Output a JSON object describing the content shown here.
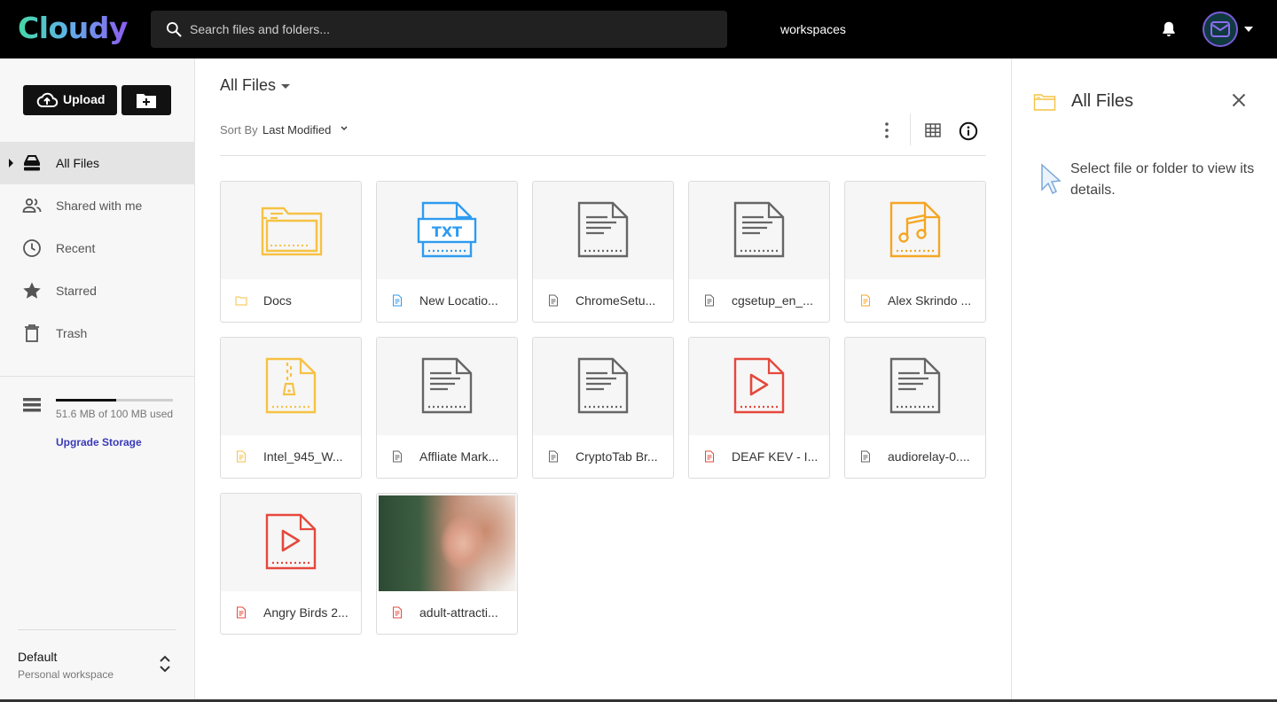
{
  "header": {
    "logo": "Cloudy",
    "search_placeholder": "Search files and folders...",
    "workspaces_label": "workspaces"
  },
  "sidebar": {
    "upload_label": "Upload",
    "nav": [
      {
        "label": "All Files",
        "icon": "hard-drive-icon",
        "active": true
      },
      {
        "label": "Shared with me",
        "icon": "people-icon"
      },
      {
        "label": "Recent",
        "icon": "clock-icon"
      },
      {
        "label": "Starred",
        "icon": "star-icon"
      },
      {
        "label": "Trash",
        "icon": "trash-icon"
      }
    ],
    "storage": {
      "used_text": "51.6 MB of 100 MB used",
      "used_fraction": 0.516,
      "upgrade_label": "Upgrade Storage"
    },
    "workspace": {
      "name": "Default",
      "subtitle": "Personal workspace"
    }
  },
  "main": {
    "title": "All Files",
    "sort_by_label": "Sort By",
    "sort_value": "Last Modified",
    "files": [
      {
        "name": "Docs",
        "type": "folder",
        "color": "#f6c244"
      },
      {
        "name": "New Locatio...",
        "type": "txt",
        "color": "#2e9bf0"
      },
      {
        "name": "ChromeSetu...",
        "type": "document",
        "color": "#666666"
      },
      {
        "name": "cgsetup_en_...",
        "type": "document",
        "color": "#666666"
      },
      {
        "name": "Alex Skrindo ...",
        "type": "audio",
        "color": "#f5a623"
      },
      {
        "name": "Intel_945_W...",
        "type": "archive",
        "color": "#f6c244"
      },
      {
        "name": "Affliate Mark...",
        "type": "document",
        "color": "#666666"
      },
      {
        "name": "CryptoTab Br...",
        "type": "document",
        "color": "#666666"
      },
      {
        "name": "DEAF KEV - I...",
        "type": "video",
        "color": "#e5483d"
      },
      {
        "name": "audiorelay-0....",
        "type": "document",
        "color": "#666666"
      },
      {
        "name": "Angry Birds 2...",
        "type": "video",
        "color": "#e5483d"
      },
      {
        "name": "adult-attracti...",
        "type": "image",
        "color": "#e5483d"
      }
    ]
  },
  "details": {
    "title": "All Files",
    "message": "Select file or folder to view its details."
  }
}
